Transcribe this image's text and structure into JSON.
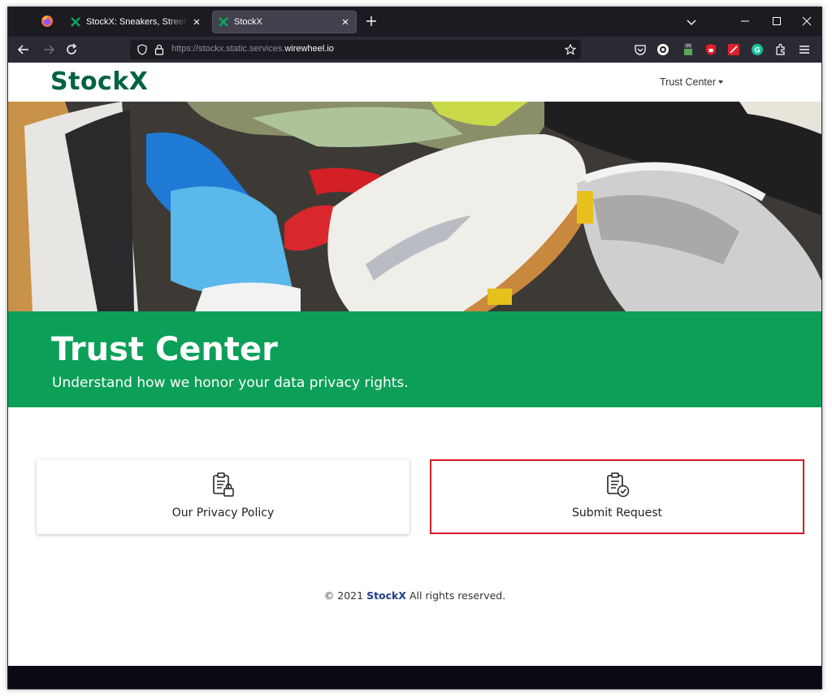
{
  "browser": {
    "tabs": [
      {
        "title": "StockX: Sneakers, Streetwear, Trading Cards",
        "active": false
      },
      {
        "title": "StockX",
        "active": true
      }
    ],
    "url_prefix": "https://stockx.static.services.",
    "url_domain": "wirewheel.io",
    "extensions": [
      "pocket-icon",
      "o-extension-icon",
      "us-vpn-icon",
      "ublock-icon",
      "pdf-icon",
      "grammarly-icon",
      "extensions-puzzle-icon",
      "menu-icon"
    ],
    "colors": {
      "tabbar": "#1c1b22",
      "navbar": "#2b2a33",
      "active_tab": "#42414d"
    }
  },
  "site": {
    "brand": "StockX",
    "nav_menu": "Trust Center",
    "colors": {
      "brand": "#006340",
      "banner": "#0c9f58",
      "highlight": "#d61b26"
    }
  },
  "banner": {
    "title": "Trust Center",
    "subtitle": "Understand how we honor your data privacy rights."
  },
  "cards": {
    "privacy_label": "Our Privacy Policy",
    "submit_label": "Submit Request"
  },
  "footer": {
    "copyright": "© 2021",
    "brand": "StockX",
    "rights": "All rights reserved."
  }
}
